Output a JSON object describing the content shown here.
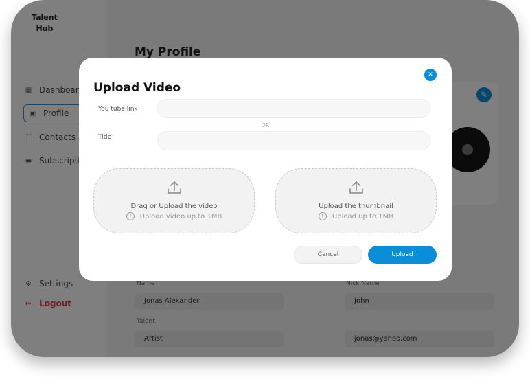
{
  "app": {
    "logo": "Talent Hub"
  },
  "sidebar": {
    "items": [
      {
        "label": "Dashboard",
        "icon": "grid-icon"
      },
      {
        "label": "Profile",
        "icon": "profile-icon"
      },
      {
        "label": "Contacts",
        "icon": "contacts-icon"
      },
      {
        "label": "Subscription",
        "icon": "card-icon"
      }
    ],
    "settings_label": "Settings",
    "logout_label": "Logout"
  },
  "page": {
    "title": "My Profile"
  },
  "profile_form": {
    "name_label": "Name",
    "name_value": "Jonas Alexander",
    "nickname_label": "Nick Name",
    "nickname_value": "John",
    "talent_label": "Talent",
    "talent_value": "Artist",
    "email_value": "jonas@yahoo.com"
  },
  "modal": {
    "title": "Upload Video",
    "youtube_label": "You tube link",
    "youtube_value": "",
    "or_text": "OR",
    "title_label": "Title",
    "title_value": "",
    "video_drop": {
      "title": "Drag or Upload the video",
      "hint": "Upload video up to 1MB"
    },
    "thumb_drop": {
      "title": "Upload the thumbnail",
      "hint": "Upload up to 1MB"
    },
    "cancel_label": "Cancel",
    "upload_label": "Upload"
  },
  "colors": {
    "accent": "#0a8ed9",
    "logout": "#e0383e",
    "overlay": "rgba(0,0,0,0.5)"
  }
}
